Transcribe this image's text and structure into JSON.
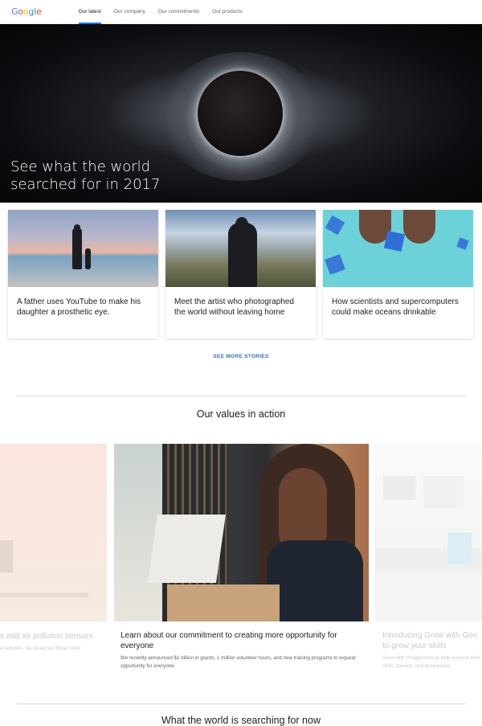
{
  "nav": {
    "logo": "Google",
    "tabs": [
      {
        "label": "Our latest"
      },
      {
        "label": "Our company"
      },
      {
        "label": "Our commitments"
      },
      {
        "label": "Our products"
      }
    ]
  },
  "hero": {
    "title": "See what the world searched for in 2017"
  },
  "stories": [
    {
      "caption": "A father uses YouTube to make his daughter a prosthetic eye."
    },
    {
      "caption": "Meet the artist who photographed the world without leaving home"
    },
    {
      "caption": "How scientists and supercomputers could make oceans drinkable"
    }
  ],
  "see_more": "SEE MORE STORIES",
  "values": {
    "title": "Our values in action",
    "cards": [
      {
        "title": "s add air pollution sensors",
        "desc": "e pollution, we tested air Street View"
      },
      {
        "title": "Learn about our commitment to creating more opportunity for everyone",
        "desc": "We recently announced $1 billion in grants, 1 million volunteer hours, and new training programs to expand opportunity for everyone."
      },
      {
        "title": "Introducing Grow with Goo to grow your skills",
        "desc": "Grow with Google aims to help everyon their skills, careers, and businesses"
      }
    ]
  },
  "searching": {
    "title": "What the world is searching for now"
  },
  "colors": {
    "accent": "#1a73e8",
    "link": "#3c6bb8"
  }
}
